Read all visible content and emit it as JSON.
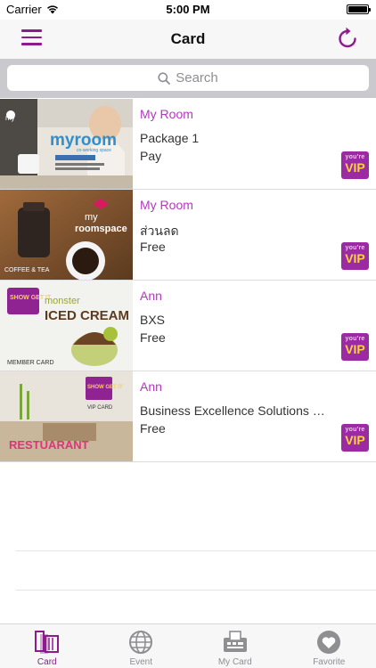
{
  "status_bar": {
    "carrier": "Carrier",
    "time": "5:00 PM"
  },
  "nav": {
    "title": "Card"
  },
  "search": {
    "placeholder": "Search"
  },
  "cards": [
    {
      "brand": "My Room",
      "title": "Package 1",
      "price": "Pay",
      "badge_top": "you're",
      "badge_main": "VIP",
      "thumb_texts": {
        "logo": "myroom",
        "sub": "co-working space",
        "caption": "my"
      }
    },
    {
      "brand": "My Room",
      "title": "ส่วนลด",
      "price": "Free",
      "badge_top": "you're",
      "badge_main": "VIP",
      "thumb_texts": {
        "brand_top": "my",
        "brand_bottom": "roomspace",
        "caption": "COFFEE & TEA"
      }
    },
    {
      "brand": "Ann",
      "title": "BXS",
      "price": "Free",
      "badge_top": "you're",
      "badge_main": "VIP",
      "thumb_texts": {
        "logo": "SHOW GET IT",
        "line1": "monster",
        "line2": "ICED CREAM",
        "caption": "MEMBER CARD"
      }
    },
    {
      "brand": "Ann",
      "title": "Business Excellence Solutions C...",
      "price": "Free",
      "badge_top": "you're",
      "badge_main": "VIP",
      "thumb_texts": {
        "logo": "SHOW GET IT",
        "sub": "VIP CARD",
        "caption": "RESTUARANT"
      }
    }
  ],
  "tabs": [
    {
      "label": "Card",
      "icon": "card-icon",
      "active": true
    },
    {
      "label": "Event",
      "icon": "globe-icon",
      "active": false
    },
    {
      "label": "My Card",
      "icon": "card-reader-icon",
      "active": false
    },
    {
      "label": "Favorite",
      "icon": "heart-icon",
      "active": false
    }
  ],
  "colors": {
    "accent": "#8e1a8e",
    "brand_text": "#b637c0",
    "vip_bg": "#9c2aa3",
    "vip_text": "#ffd23f"
  }
}
